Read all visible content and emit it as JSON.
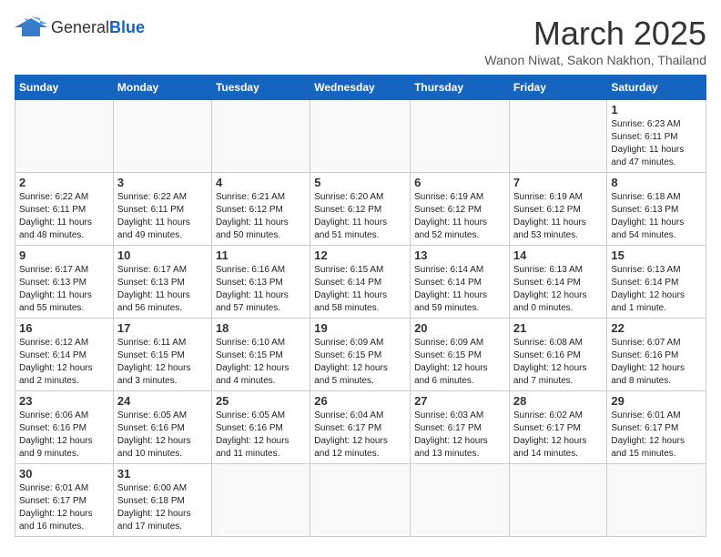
{
  "header": {
    "logo_general": "General",
    "logo_blue": "Blue",
    "month_title": "March 2025",
    "location": "Wanon Niwat, Sakon Nakhon, Thailand"
  },
  "days_of_week": [
    "Sunday",
    "Monday",
    "Tuesday",
    "Wednesday",
    "Thursday",
    "Friday",
    "Saturday"
  ],
  "weeks": [
    [
      {
        "day": "",
        "info": ""
      },
      {
        "day": "",
        "info": ""
      },
      {
        "day": "",
        "info": ""
      },
      {
        "day": "",
        "info": ""
      },
      {
        "day": "",
        "info": ""
      },
      {
        "day": "",
        "info": ""
      },
      {
        "day": "1",
        "info": "Sunrise: 6:23 AM\nSunset: 6:11 PM\nDaylight: 11 hours\nand 47 minutes."
      }
    ],
    [
      {
        "day": "2",
        "info": "Sunrise: 6:22 AM\nSunset: 6:11 PM\nDaylight: 11 hours\nand 48 minutes."
      },
      {
        "day": "3",
        "info": "Sunrise: 6:22 AM\nSunset: 6:11 PM\nDaylight: 11 hours\nand 49 minutes."
      },
      {
        "day": "4",
        "info": "Sunrise: 6:21 AM\nSunset: 6:12 PM\nDaylight: 11 hours\nand 50 minutes."
      },
      {
        "day": "5",
        "info": "Sunrise: 6:20 AM\nSunset: 6:12 PM\nDaylight: 11 hours\nand 51 minutes."
      },
      {
        "day": "6",
        "info": "Sunrise: 6:19 AM\nSunset: 6:12 PM\nDaylight: 11 hours\nand 52 minutes."
      },
      {
        "day": "7",
        "info": "Sunrise: 6:19 AM\nSunset: 6:12 PM\nDaylight: 11 hours\nand 53 minutes."
      },
      {
        "day": "8",
        "info": "Sunrise: 6:18 AM\nSunset: 6:13 PM\nDaylight: 11 hours\nand 54 minutes."
      }
    ],
    [
      {
        "day": "9",
        "info": "Sunrise: 6:17 AM\nSunset: 6:13 PM\nDaylight: 11 hours\nand 55 minutes."
      },
      {
        "day": "10",
        "info": "Sunrise: 6:17 AM\nSunset: 6:13 PM\nDaylight: 11 hours\nand 56 minutes."
      },
      {
        "day": "11",
        "info": "Sunrise: 6:16 AM\nSunset: 6:13 PM\nDaylight: 11 hours\nand 57 minutes."
      },
      {
        "day": "12",
        "info": "Sunrise: 6:15 AM\nSunset: 6:14 PM\nDaylight: 11 hours\nand 58 minutes."
      },
      {
        "day": "13",
        "info": "Sunrise: 6:14 AM\nSunset: 6:14 PM\nDaylight: 11 hours\nand 59 minutes."
      },
      {
        "day": "14",
        "info": "Sunrise: 6:13 AM\nSunset: 6:14 PM\nDaylight: 12 hours\nand 0 minutes."
      },
      {
        "day": "15",
        "info": "Sunrise: 6:13 AM\nSunset: 6:14 PM\nDaylight: 12 hours\nand 1 minute."
      }
    ],
    [
      {
        "day": "16",
        "info": "Sunrise: 6:12 AM\nSunset: 6:14 PM\nDaylight: 12 hours\nand 2 minutes."
      },
      {
        "day": "17",
        "info": "Sunrise: 6:11 AM\nSunset: 6:15 PM\nDaylight: 12 hours\nand 3 minutes."
      },
      {
        "day": "18",
        "info": "Sunrise: 6:10 AM\nSunset: 6:15 PM\nDaylight: 12 hours\nand 4 minutes."
      },
      {
        "day": "19",
        "info": "Sunrise: 6:09 AM\nSunset: 6:15 PM\nDaylight: 12 hours\nand 5 minutes."
      },
      {
        "day": "20",
        "info": "Sunrise: 6:09 AM\nSunset: 6:15 PM\nDaylight: 12 hours\nand 6 minutes."
      },
      {
        "day": "21",
        "info": "Sunrise: 6:08 AM\nSunset: 6:16 PM\nDaylight: 12 hours\nand 7 minutes."
      },
      {
        "day": "22",
        "info": "Sunrise: 6:07 AM\nSunset: 6:16 PM\nDaylight: 12 hours\nand 8 minutes."
      }
    ],
    [
      {
        "day": "23",
        "info": "Sunrise: 6:06 AM\nSunset: 6:16 PM\nDaylight: 12 hours\nand 9 minutes."
      },
      {
        "day": "24",
        "info": "Sunrise: 6:05 AM\nSunset: 6:16 PM\nDaylight: 12 hours\nand 10 minutes."
      },
      {
        "day": "25",
        "info": "Sunrise: 6:05 AM\nSunset: 6:16 PM\nDaylight: 12 hours\nand 11 minutes."
      },
      {
        "day": "26",
        "info": "Sunrise: 6:04 AM\nSunset: 6:17 PM\nDaylight: 12 hours\nand 12 minutes."
      },
      {
        "day": "27",
        "info": "Sunrise: 6:03 AM\nSunset: 6:17 PM\nDaylight: 12 hours\nand 13 minutes."
      },
      {
        "day": "28",
        "info": "Sunrise: 6:02 AM\nSunset: 6:17 PM\nDaylight: 12 hours\nand 14 minutes."
      },
      {
        "day": "29",
        "info": "Sunrise: 6:01 AM\nSunset: 6:17 PM\nDaylight: 12 hours\nand 15 minutes."
      }
    ],
    [
      {
        "day": "30",
        "info": "Sunrise: 6:01 AM\nSunset: 6:17 PM\nDaylight: 12 hours\nand 16 minutes."
      },
      {
        "day": "31",
        "info": "Sunrise: 6:00 AM\nSunset: 6:18 PM\nDaylight: 12 hours\nand 17 minutes."
      },
      {
        "day": "",
        "info": ""
      },
      {
        "day": "",
        "info": ""
      },
      {
        "day": "",
        "info": ""
      },
      {
        "day": "",
        "info": ""
      },
      {
        "day": "",
        "info": ""
      }
    ]
  ]
}
